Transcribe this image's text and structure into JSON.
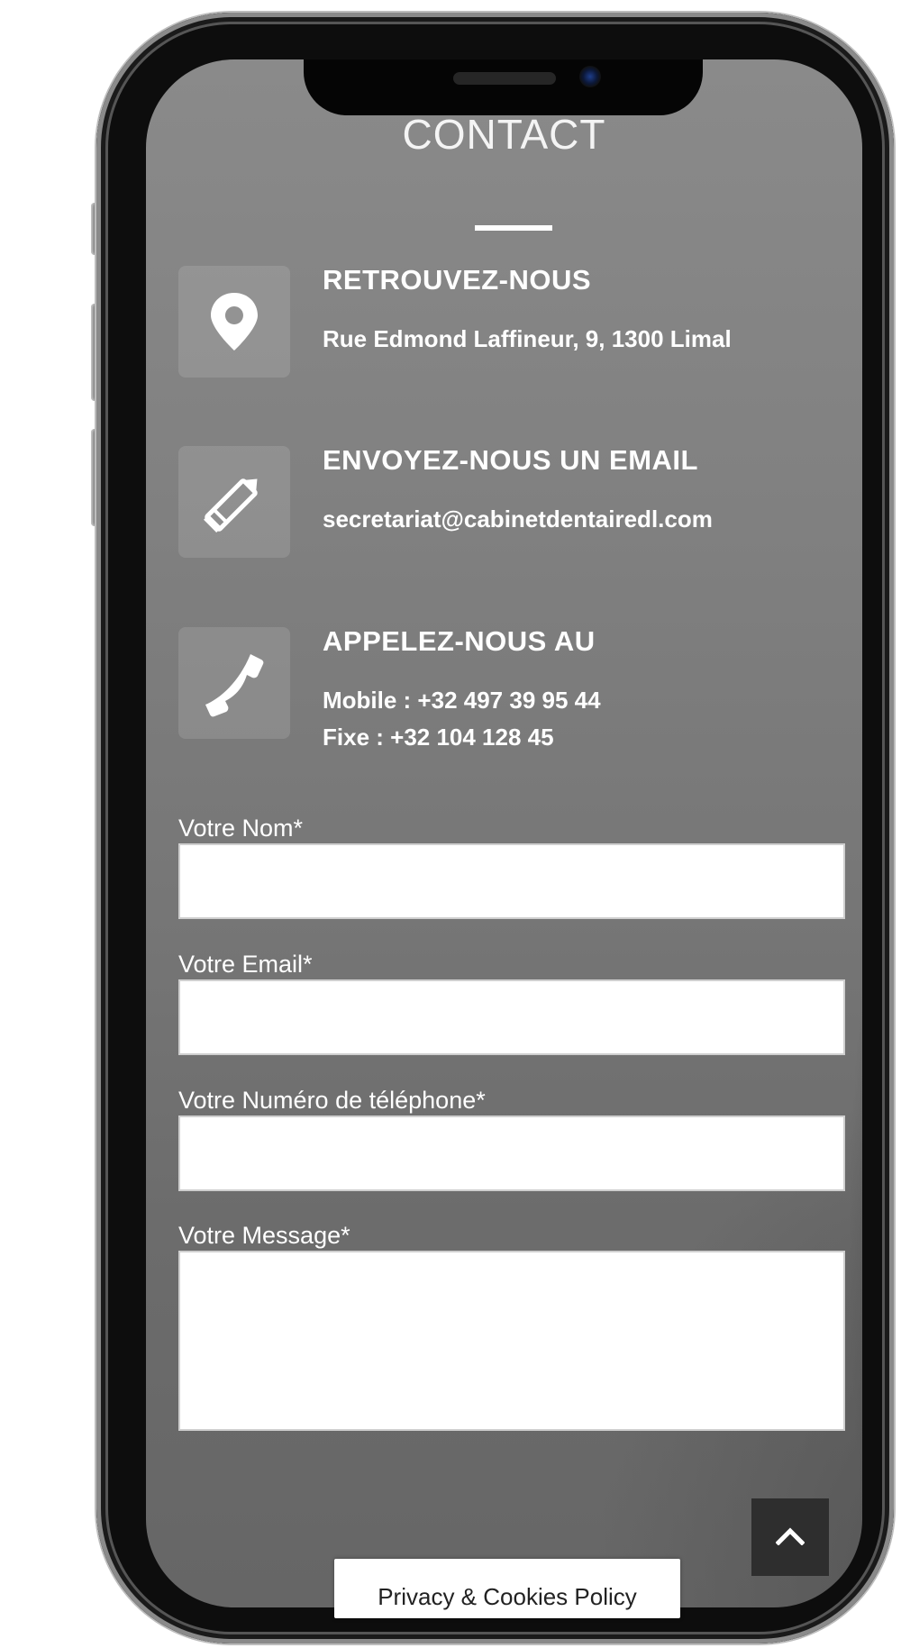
{
  "section": {
    "title": "CONTACT"
  },
  "info": [
    {
      "icon": "map-marker-icon",
      "heading": "RETROUVEZ-NOUS",
      "lines": [
        "Rue Edmond Laffineur, 9, 1300 Limal"
      ]
    },
    {
      "icon": "pencil-icon",
      "heading": "ENVOYEZ-NOUS UN EMAIL",
      "lines": [
        "secretariat@cabinetdentairedl.com"
      ]
    },
    {
      "icon": "phone-icon",
      "heading": "APPELEZ-NOUS AU",
      "lines": [
        "Mobile : +32 497 39 95 44",
        "Fixe : +32 104 128 45"
      ]
    }
  ],
  "form": {
    "name_label": "Votre Nom*",
    "name_value": "",
    "email_label": "Votre Email*",
    "email_value": "",
    "phone_label": "Votre Numéro de téléphone*",
    "phone_value": "",
    "message_label": "Votre Message*",
    "message_value": ""
  },
  "back_to_top": {
    "icon": "chevron-up-icon"
  },
  "privacy_bar": {
    "label": "Privacy & Cookies Policy"
  },
  "colors": {
    "panel": "#7a7a7a",
    "text": "#ffffff",
    "button": "#2e2e2e"
  }
}
